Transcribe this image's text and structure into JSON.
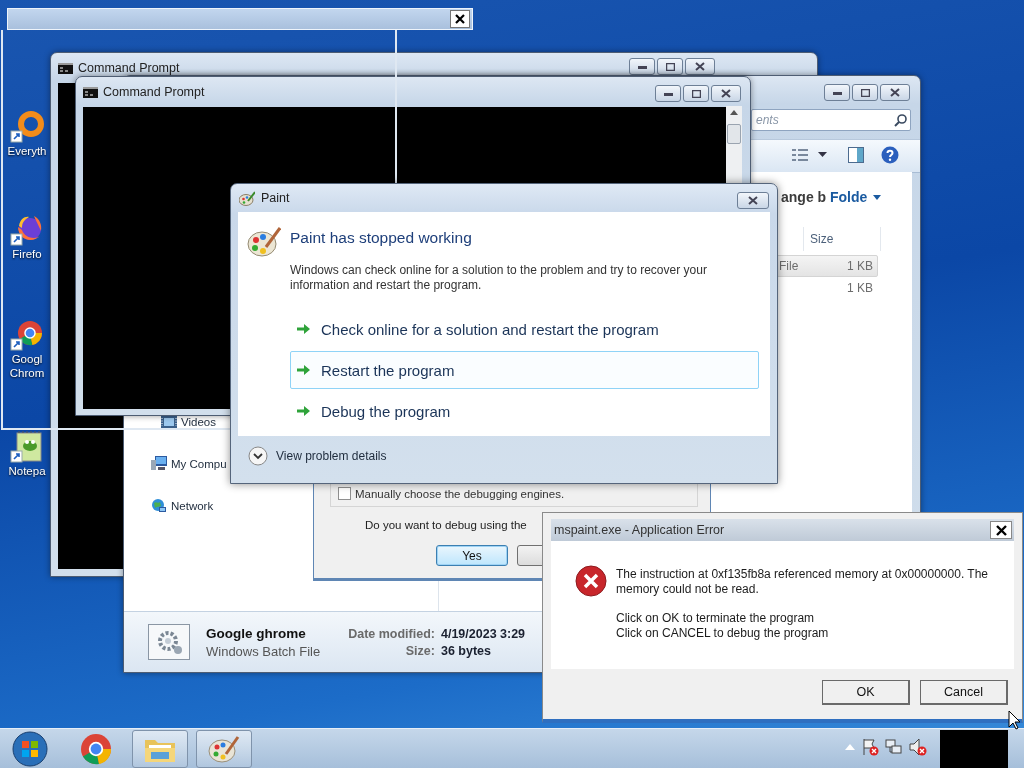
{
  "desktop_icons": [
    {
      "kind": "ring",
      "lines": [
        "Everyth"
      ]
    },
    {
      "kind": "fox",
      "lines": [
        "Firefo"
      ]
    },
    {
      "kind": "wheel",
      "lines": [
        "Googl",
        "Chrom"
      ]
    },
    {
      "kind": "notepad",
      "lines": [
        "Notepa"
      ]
    }
  ],
  "back_console": {
    "title": "Command Prompt"
  },
  "explorer": {
    "search": {
      "placeholder": "ents"
    },
    "arrange_label": "ange b",
    "arrange_value": "Folde",
    "columns": [
      "Size"
    ],
    "rows": [
      {
        "type": "File",
        "size": "1 KB",
        "selected": true
      },
      {
        "size": "1 KB",
        "selected": false
      }
    ],
    "nav_items": [
      {
        "kind": "videos",
        "label": "Videos"
      },
      {
        "kind": "computer",
        "label": "My Compu"
      },
      {
        "kind": "network",
        "label": "Network"
      }
    ],
    "details": {
      "name": "Google ghrome",
      "type": "Windows Batch File",
      "fields": [
        {
          "label": "Date modified:",
          "value": "4/19/2023 3:29"
        },
        {
          "label": "Size:",
          "value": "36 bytes"
        }
      ]
    }
  },
  "front_console": {
    "title": "Command Prompt"
  },
  "debugger": {
    "checkbox": {
      "label": "Manually choose the debugging engines.",
      "checked": false
    },
    "question": "Do you want to debug using the",
    "buttons": [
      {
        "label": "Yes",
        "default": true
      }
    ]
  },
  "paint_dialog": {
    "title": "Paint",
    "heading": "Paint has stopped working",
    "message": "Windows can check online for a solution to the problem and try to recover your information and restart the program.",
    "options": [
      {
        "label": "Check online for a solution and restart the program",
        "selected": false
      },
      {
        "label": "Restart the program",
        "selected": true
      },
      {
        "label": "Debug the program",
        "selected": false
      }
    ],
    "details_toggle": "View problem details"
  },
  "error_dialog": {
    "title": "mspaint.exe - Application Error",
    "message": "The instruction at 0xf135fb8a referenced memory at 0x00000000. The memory could not be read.",
    "instructions": [
      "Click on OK to terminate the program",
      "Click on CANCEL to debug the program"
    ],
    "buttons": [
      "OK",
      "Cancel"
    ]
  },
  "taskbar": {
    "items": [
      {
        "kind": "wheel",
        "running": false
      },
      {
        "kind": "folder",
        "running": true
      },
      {
        "kind": "palette",
        "running": true
      }
    ]
  }
}
